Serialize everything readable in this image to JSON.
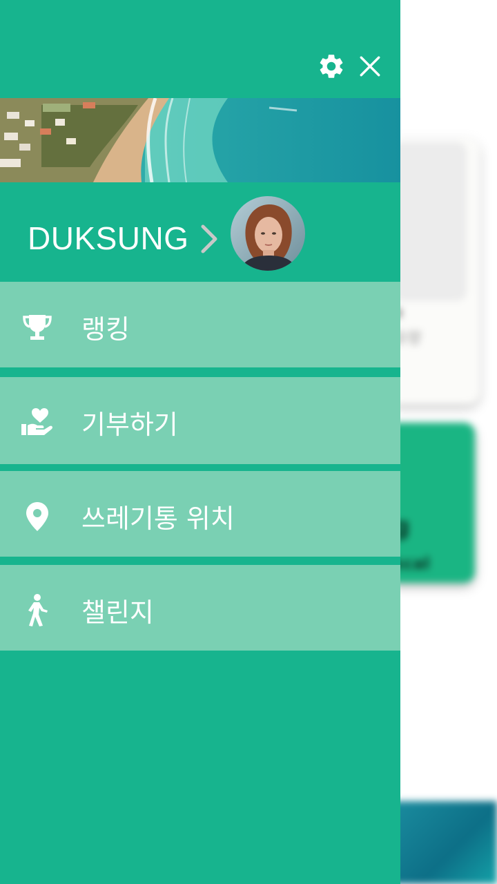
{
  "drawer": {
    "profile": {
      "name": "DUKSUNG"
    },
    "menu": [
      {
        "id": "ranking",
        "label": "랭킹",
        "icon": "trophy-icon"
      },
      {
        "id": "donate",
        "label": "기부하기",
        "icon": "hand-heart-icon"
      },
      {
        "id": "trash-bin-location",
        "label": "쓰레기통 위치",
        "icon": "map-pin-icon"
      },
      {
        "id": "challenge",
        "label": "챌린지",
        "icon": "walking-person-icon"
      }
    ],
    "topbar_icons": [
      "gear-icon",
      "close-icon"
    ]
  },
  "background": {
    "card_text_1": "a",
    "card_text_2": "유량",
    "green_card_text_1": "g",
    "green_card_text_2": "kcal"
  },
  "colors": {
    "drawer_bg": "#17b48e",
    "menu_item_bg": "#7ad0b3",
    "text": "#ffffff",
    "chevron": "#c8c8c8"
  }
}
